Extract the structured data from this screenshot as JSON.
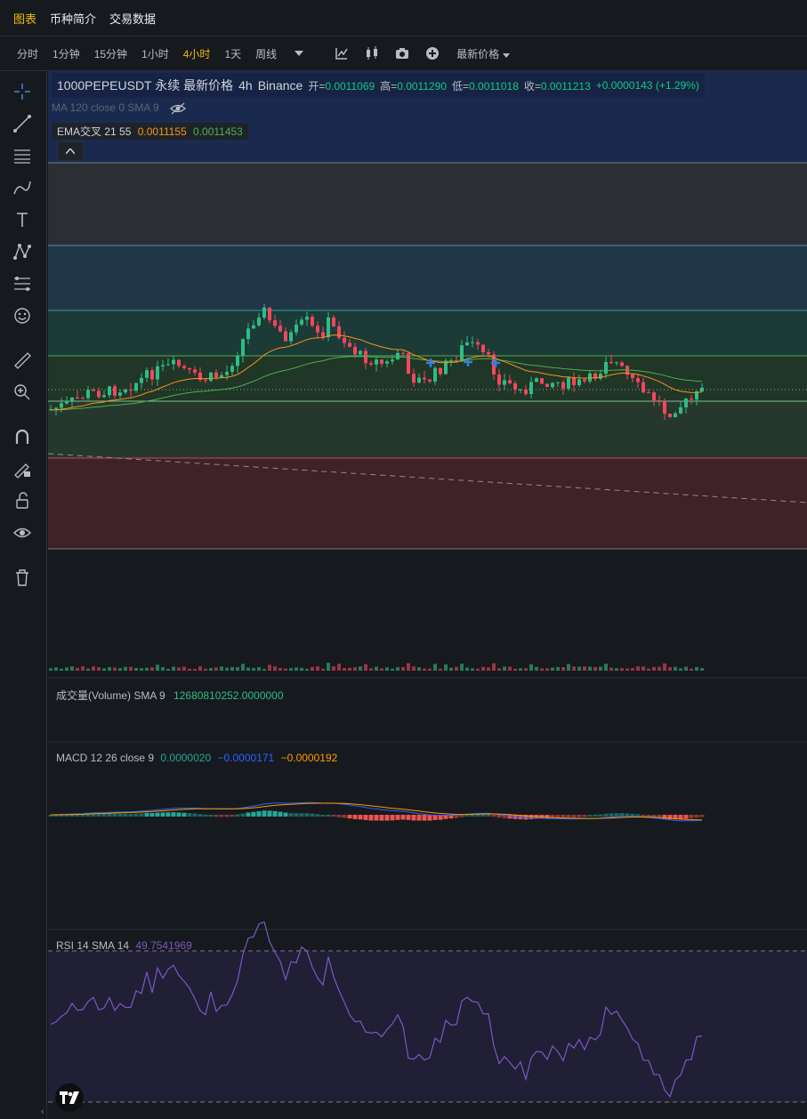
{
  "nav": {
    "tabs": [
      "图表",
      "币种简介",
      "交易数据"
    ],
    "active": 0
  },
  "toolbar": {
    "timeframes": [
      "分时",
      "1分钟",
      "15分钟",
      "1小时",
      "4小时",
      "1天",
      "周线"
    ],
    "active_tf": 4,
    "price_mode": "最新价格"
  },
  "legend": {
    "symbol": "1000PEPEUSDT 永续 最新价格",
    "interval": "4h",
    "exchange": "Binance",
    "open_label": "开=",
    "open": "0.0011069",
    "high_label": "高=",
    "high": "0.0011290",
    "low_label": "低=",
    "low": "0.0011018",
    "close_label": "收=",
    "close": "0.0011213",
    "change": "+0.0000143 (+1.29%)"
  },
  "indicators": {
    "ma": "MA 120 close 0 SMA 9",
    "ema_label": "EMA交叉 21 55",
    "ema_fast": "0.0011155",
    "ema_slow": "0.0011453"
  },
  "volume": {
    "label": "成交量(Volume) SMA 9",
    "value": "12680810252.0000000"
  },
  "macd": {
    "label": "MACD 12 26 close 9",
    "v1": "0.0000020",
    "v2": "−0.0000171",
    "v3": "−0.0000192"
  },
  "rsi": {
    "label": "RSI 14 SMA 14",
    "value": "49.7541969"
  },
  "colors": {
    "up": "#2ebd85",
    "down": "#f6465d",
    "accent": "#f0b90b",
    "ema_fast": "#f7931a",
    "ema_slow": "#4caf50",
    "rsi": "#7e57c2"
  }
}
